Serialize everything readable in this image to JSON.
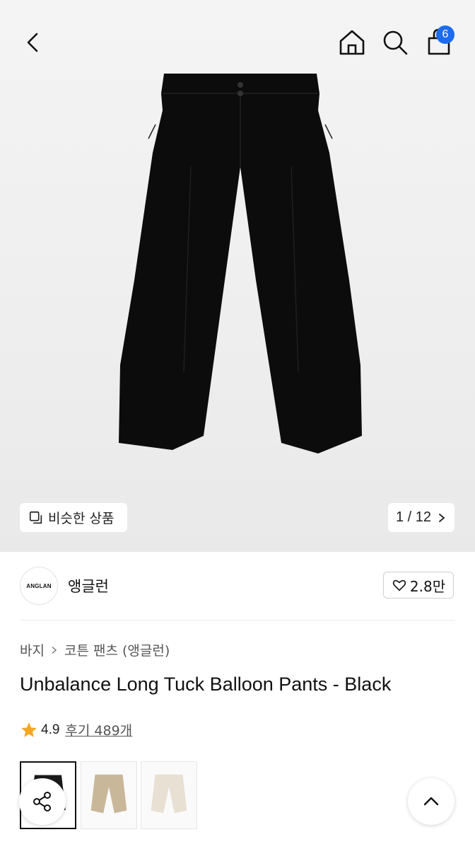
{
  "header": {
    "back_icon": "chevron-left-icon",
    "home_icon": "home-icon",
    "search_icon": "search-icon",
    "cart_icon": "shopping-bag-icon",
    "cart_count": "6"
  },
  "gallery": {
    "similar_label": "비슷한 상품",
    "page_indicator": "1 / 12"
  },
  "brand": {
    "logo_text": "ANGLAN",
    "name": "앵글런",
    "likes": "2.8만"
  },
  "product": {
    "breadcrumb": [
      "바지",
      "코튼 팬츠 (앵글런)"
    ],
    "title": "Unbalance Long Tuck Balloon Pants - Black",
    "rating": "4.9",
    "reviews_label": "후기 489개"
  },
  "swatches": [
    {
      "color": "#1a1a1a",
      "selected": true
    },
    {
      "color": "#c9b79a",
      "selected": false
    },
    {
      "color": "#e8e0d3",
      "selected": false
    }
  ],
  "colors": {
    "accent_badge": "#1d6cf0",
    "star": "#f5a623"
  }
}
